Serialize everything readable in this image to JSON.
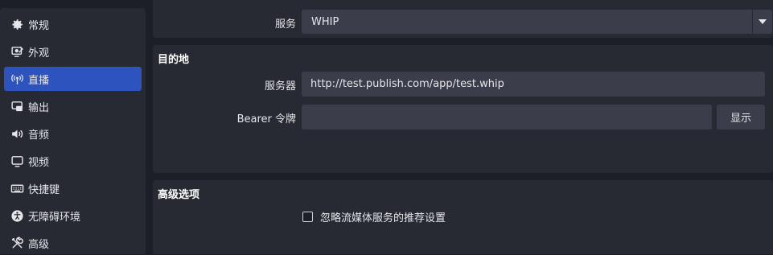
{
  "sidebar": {
    "items": [
      {
        "label": "常规",
        "icon": "gear-icon",
        "active": false
      },
      {
        "label": "外观",
        "icon": "appearance-icon",
        "active": false
      },
      {
        "label": "直播",
        "icon": "broadcast-icon",
        "active": true
      },
      {
        "label": "输出",
        "icon": "output-icon",
        "active": false
      },
      {
        "label": "音频",
        "icon": "speaker-icon",
        "active": false
      },
      {
        "label": "视频",
        "icon": "monitor-icon",
        "active": false
      },
      {
        "label": "快捷键",
        "icon": "keyboard-icon",
        "active": false
      },
      {
        "label": "无障碍环境",
        "icon": "accessibility-icon",
        "active": false
      },
      {
        "label": "高级",
        "icon": "tools-icon",
        "active": false
      }
    ],
    "active_color": "#2c53be"
  },
  "service": {
    "label": "服务",
    "value": "WHIP"
  },
  "destination": {
    "title": "目的地",
    "server_label": "服务器",
    "server_value": "http://test.publish.com/app/test.whip",
    "token_label": "Bearer 令牌",
    "token_value": "",
    "show_button": "显示"
  },
  "advanced": {
    "title": "高级选项",
    "ignore_recommended_label": "忽略流媒体服务的推荐设置",
    "ignore_recommended_checked": false
  }
}
